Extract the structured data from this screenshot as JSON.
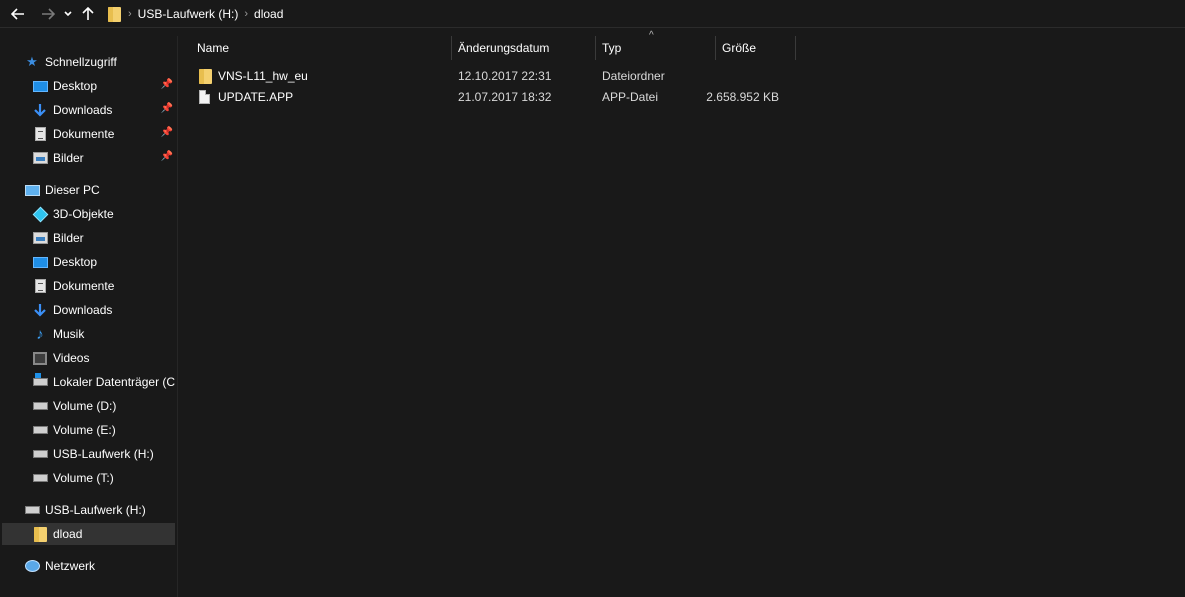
{
  "toolbar": {
    "back_glyph": "🡐",
    "forward_glyph": "🡒",
    "recent_glyph": "⌄",
    "up_glyph": "🡑"
  },
  "address": {
    "separator": "›",
    "crumbs": [
      "USB-Laufwerk (H:)",
      "dload"
    ]
  },
  "sidebar": {
    "quick_access": {
      "label": "Schnellzugriff",
      "items": [
        {
          "label": "Desktop",
          "icon": "desktop-icon",
          "pinned": true
        },
        {
          "label": "Downloads",
          "icon": "downloads-icon",
          "pinned": true
        },
        {
          "label": "Dokumente",
          "icon": "documents-icon",
          "pinned": true
        },
        {
          "label": "Bilder",
          "icon": "pictures-icon",
          "pinned": true
        }
      ]
    },
    "this_pc": {
      "label": "Dieser PC",
      "items": [
        {
          "label": "3D-Objekte",
          "icon": "3d-objects-icon"
        },
        {
          "label": "Bilder",
          "icon": "pictures-icon"
        },
        {
          "label": "Desktop",
          "icon": "desktop-icon"
        },
        {
          "label": "Dokumente",
          "icon": "documents-icon"
        },
        {
          "label": "Downloads",
          "icon": "downloads-icon"
        },
        {
          "label": "Musik",
          "icon": "music-icon"
        },
        {
          "label": "Videos",
          "icon": "videos-icon"
        },
        {
          "label": "Lokaler Datenträger (C:)",
          "icon": "local-disk-icon"
        },
        {
          "label": "Volume (D:)",
          "icon": "drive-icon"
        },
        {
          "label": "Volume (E:)",
          "icon": "drive-icon"
        },
        {
          "label": "USB-Laufwerk (H:)",
          "icon": "usb-drive-icon"
        },
        {
          "label": "Volume (T:)",
          "icon": "drive-icon"
        }
      ]
    },
    "usb_drive": {
      "label": "USB-Laufwerk (H:)",
      "child": {
        "label": "dload",
        "icon": "folder-icon",
        "selected": true
      }
    },
    "network": {
      "label": "Netzwerk",
      "icon": "network-icon"
    },
    "pin_glyph": "📌"
  },
  "columns": {
    "name": "Name",
    "date": "Änderungsdatum",
    "type": "Typ",
    "size": "Größe",
    "sort_glyph": "^"
  },
  "files": [
    {
      "name": "VNS-L11_hw_eu",
      "date": "12.10.2017 22:31",
      "type": "Dateiordner",
      "size": "",
      "icon": "folder-icon"
    },
    {
      "name": "UPDATE.APP",
      "date": "21.07.2017 18:32",
      "type": "APP-Datei",
      "size": "2.658.952 KB",
      "icon": "file-icon"
    }
  ],
  "colors": {
    "background": "#191919",
    "selection": "#333333",
    "accent_blue": "#3b8de0",
    "folder_yellow": "#f4d06f"
  }
}
